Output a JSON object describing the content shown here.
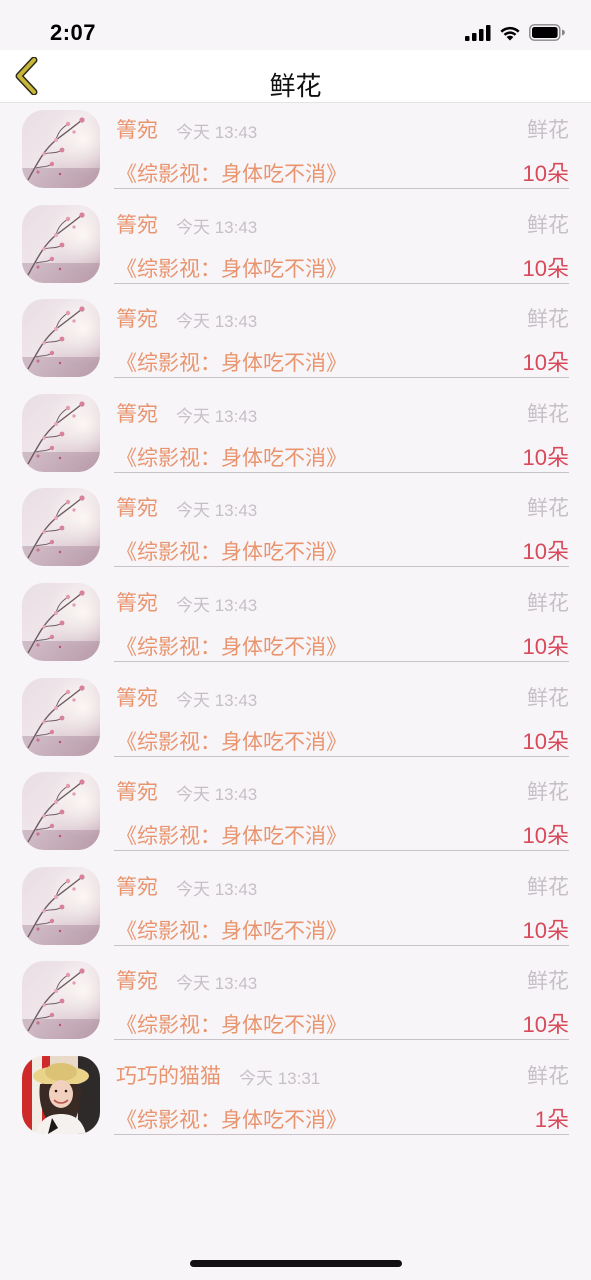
{
  "status_bar": {
    "time": "2:07"
  },
  "nav": {
    "title": "鲜花",
    "back_icon": "chevron-left-icon"
  },
  "colors": {
    "accent_orange": "#e8956f",
    "count_red": "#d84a5a",
    "muted_gray": "#c6c0c6",
    "back_icon": "#b8a422"
  },
  "records": [
    {
      "user": "箐宛",
      "time": "今天 13:43",
      "gift": "鲜花",
      "title": "《综影视：身体吃不消》",
      "count": "10朵",
      "avatar": "flower-avatar"
    },
    {
      "user": "箐宛",
      "time": "今天 13:43",
      "gift": "鲜花",
      "title": "《综影视：身体吃不消》",
      "count": "10朵",
      "avatar": "flower-avatar"
    },
    {
      "user": "箐宛",
      "time": "今天 13:43",
      "gift": "鲜花",
      "title": "《综影视：身体吃不消》",
      "count": "10朵",
      "avatar": "flower-avatar"
    },
    {
      "user": "箐宛",
      "time": "今天 13:43",
      "gift": "鲜花",
      "title": "《综影视：身体吃不消》",
      "count": "10朵",
      "avatar": "flower-avatar"
    },
    {
      "user": "箐宛",
      "time": "今天 13:43",
      "gift": "鲜花",
      "title": "《综影视：身体吃不消》",
      "count": "10朵",
      "avatar": "flower-avatar"
    },
    {
      "user": "箐宛",
      "time": "今天 13:43",
      "gift": "鲜花",
      "title": "《综影视：身体吃不消》",
      "count": "10朵",
      "avatar": "flower-avatar"
    },
    {
      "user": "箐宛",
      "time": "今天 13:43",
      "gift": "鲜花",
      "title": "《综影视：身体吃不消》",
      "count": "10朵",
      "avatar": "flower-avatar"
    },
    {
      "user": "箐宛",
      "time": "今天 13:43",
      "gift": "鲜花",
      "title": "《综影视：身体吃不消》",
      "count": "10朵",
      "avatar": "flower-avatar"
    },
    {
      "user": "箐宛",
      "time": "今天 13:43",
      "gift": "鲜花",
      "title": "《综影视：身体吃不消》",
      "count": "10朵",
      "avatar": "flower-avatar"
    },
    {
      "user": "箐宛",
      "time": "今天 13:43",
      "gift": "鲜花",
      "title": "《综影视：身体吃不消》",
      "count": "10朵",
      "avatar": "flower-avatar"
    },
    {
      "user": "巧巧的猫猫",
      "time": "今天 13:31",
      "gift": "鲜花",
      "title": "《综影视：身体吃不消》",
      "count": "1朵",
      "avatar": "photo-avatar"
    }
  ]
}
